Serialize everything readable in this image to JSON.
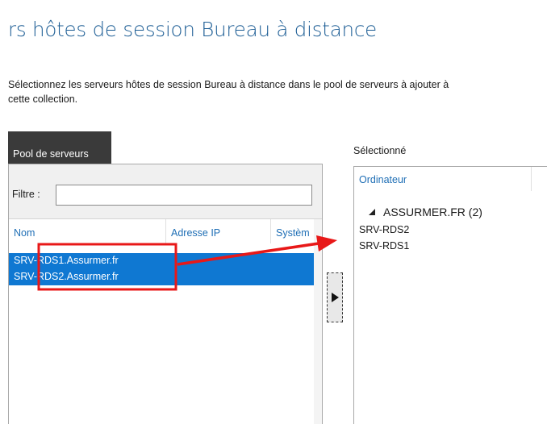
{
  "page": {
    "title": "rs hôtes de session Bureau à distance",
    "description_line1": "Sélectionnez les serveurs hôtes de session Bureau à distance dans le pool de serveurs à ajouter à",
    "description_line2": "cette collection."
  },
  "pool": {
    "tab_label": "Pool de serveurs",
    "filter_label": "Filtre :",
    "filter_value": "",
    "columns": [
      "Nom",
      "Adresse IP",
      "Systèm"
    ],
    "rows": [
      {
        "name": "SRV-RDS1.Assurmer.fr"
      },
      {
        "name": "SRV-RDS2.Assurmer.fr"
      }
    ]
  },
  "selected": {
    "title": "Sélectionné",
    "column": "Ordinateur",
    "group_label": "ASSURMER.FR (2)",
    "items": [
      "SRV-RDS2",
      "SRV-RDS1"
    ]
  },
  "colors": {
    "accent": "#1f5f96",
    "selection": "#0f78d2",
    "annotation": "#e81818"
  },
  "icons": {
    "move": "arrow-right-icon",
    "expand": "triangle-down-icon"
  }
}
